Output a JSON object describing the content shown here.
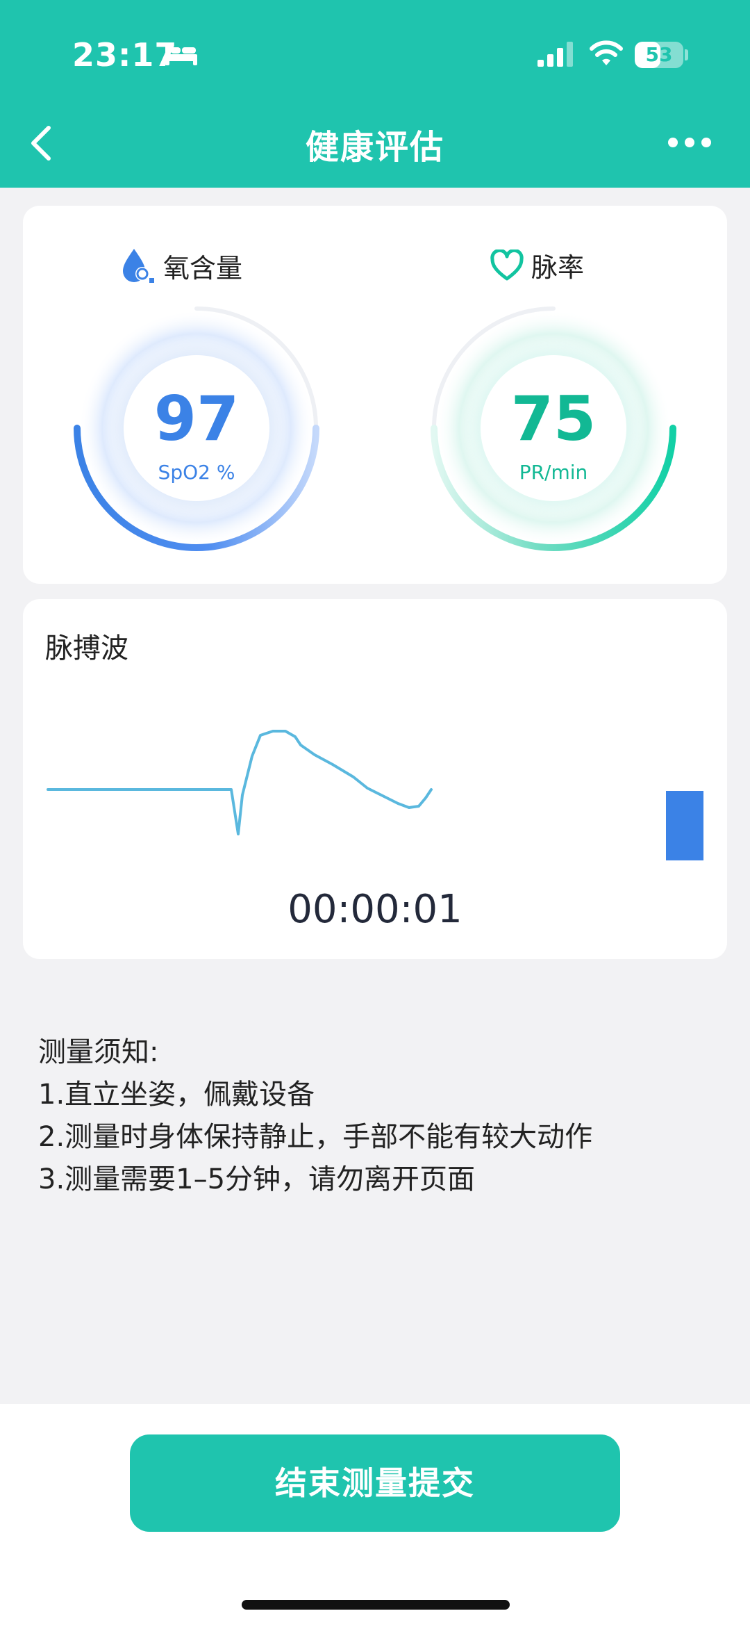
{
  "status_bar": {
    "time": "23:17",
    "battery": "53",
    "battery_level": 0.53
  },
  "nav": {
    "title": "健康评估"
  },
  "metrics": [
    {
      "label": "氧含量",
      "value": "97",
      "unit": "SpO2 %",
      "color": "#3b82e6",
      "icon": "water-drop-o2-icon"
    },
    {
      "label": "脉率",
      "value": "75",
      "unit": "PR/min",
      "color": "#12c4a0",
      "icon": "heart-outline-icon"
    }
  ],
  "wave": {
    "title": "脉搏波",
    "timer": "00:00:01",
    "line_color": "#5ab8de",
    "bar_color": "#3b82e6"
  },
  "notes": {
    "heading": "测量须知:",
    "items": [
      "1.直立坐姿，佩戴设备",
      "2.测量时身体保持静止，手部不能有较大动作",
      "3.测量需要1–5分钟，请勿离开页面"
    ]
  },
  "submit": {
    "label": "结束测量提交"
  },
  "colors": {
    "brand": "#1fc4ae",
    "background": "#f2f2f4"
  }
}
